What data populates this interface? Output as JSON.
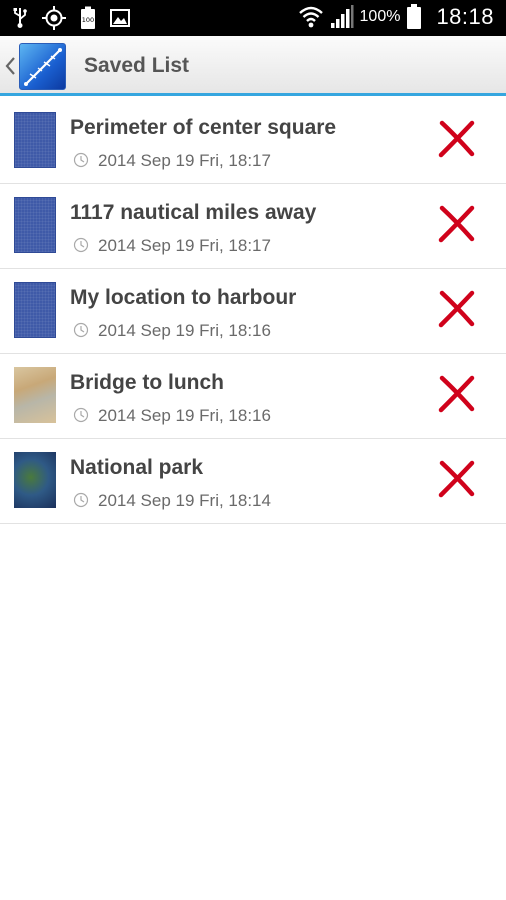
{
  "status_bar": {
    "battery_percent": "100%",
    "clock": "18:18",
    "icons": [
      "usb-icon",
      "gps-icon",
      "battery-saver-icon",
      "image-icon",
      "wifi-icon",
      "signal-icon",
      "battery-icon"
    ],
    "mini_battery_label": "100"
  },
  "action_bar": {
    "title": "Saved List",
    "back_icon": "chevron-left-icon",
    "app_icon": "app-logo-icon"
  },
  "list": {
    "items": [
      {
        "title": "Perimeter of center square",
        "time": "2014 Sep 19 Fri, 18:17",
        "thumb": "blue"
      },
      {
        "title": "1117 nautical miles away",
        "time": "2014 Sep 19 Fri, 18:17",
        "thumb": "blue"
      },
      {
        "title": "My location to harbour",
        "time": "2014 Sep 19 Fri, 18:16",
        "thumb": "blue"
      },
      {
        "title": "Bridge to lunch",
        "time": "2014 Sep 19 Fri, 18:16",
        "thumb": "sand"
      },
      {
        "title": "National park",
        "time": "2014 Sep 19 Fri, 18:14",
        "thumb": "earth"
      }
    ]
  },
  "colors": {
    "accent": "#36a6df",
    "delete": "#d0021b"
  }
}
